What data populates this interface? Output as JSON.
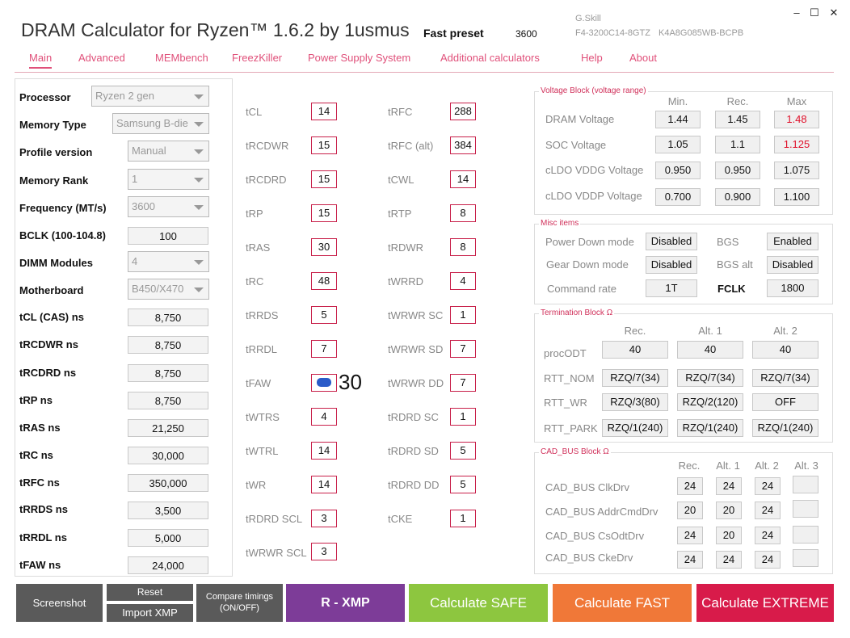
{
  "app": {
    "title": "DRAM Calculator for Ryzen™ 1.6.2 by 1usmus",
    "fast_preset_label": "Fast preset",
    "fast_preset_value": "3600",
    "ram_brand": "G.Skill",
    "ram_model": "F4-3200C14-8GTZ",
    "ram_part": "K4A8G085WB-BCPB",
    "win_minimize": "–",
    "win_maximize": "☐",
    "win_close": "✕"
  },
  "nav": {
    "tabs": [
      "Main",
      "Advanced",
      "MEMbench",
      "FreezKiller",
      "Power Supply System",
      "Additional calculators",
      "Help",
      "About"
    ],
    "active": "Main"
  },
  "left": {
    "processor_label": "Processor",
    "processor_value": "Ryzen 2 gen",
    "memory_type_label": "Memory Type",
    "memory_type_value": "Samsung B-die",
    "profile_label": "Profile version",
    "profile_value": "Manual",
    "rank_label": "Memory Rank",
    "rank_value": "1",
    "freq_label": "Frequency (MT/s)",
    "freq_value": "3600",
    "bclk_label": "BCLK (100-104.8)",
    "bclk_value": "100",
    "dimm_label": "DIMM Modules",
    "dimm_value": "4",
    "mb_label": "Motherboard",
    "mb_value": "B450/X470",
    "ns_rows": [
      {
        "label": "tCL (CAS) ns",
        "value": "8,750"
      },
      {
        "label": "tRCDWR ns",
        "value": "8,750"
      },
      {
        "label": "tRCDRD ns",
        "value": "8,750"
      },
      {
        "label": "tRP ns",
        "value": "8,750"
      },
      {
        "label": "tRAS ns",
        "value": "21,250"
      },
      {
        "label": "tRC ns",
        "value": "30,000"
      },
      {
        "label": "tRFC ns",
        "value": "350,000"
      },
      {
        "label": "tRRDS ns",
        "value": "3,500"
      },
      {
        "label": "tRRDL ns",
        "value": "5,000"
      },
      {
        "label": "tFAW ns",
        "value": "24,000"
      }
    ]
  },
  "timings": {
    "col1": [
      {
        "label": "tCL",
        "value": "14"
      },
      {
        "label": "tRCDWR",
        "value": "15"
      },
      {
        "label": "tRCDRD",
        "value": "15"
      },
      {
        "label": "tRP",
        "value": "15"
      },
      {
        "label": "tRAS",
        "value": "30"
      },
      {
        "label": "tRC",
        "value": "48"
      },
      {
        "label": "tRRDS",
        "value": "5"
      },
      {
        "label": "tRRDL",
        "value": "7"
      },
      {
        "label": "tFAW",
        "value": ""
      },
      {
        "label": "tWTRS",
        "value": "4"
      },
      {
        "label": "tWTRL",
        "value": "14"
      },
      {
        "label": "tWR",
        "value": "14"
      },
      {
        "label": "tRDRD SCL",
        "value": "3"
      },
      {
        "label": "tWRWR SCL",
        "value": "3"
      }
    ],
    "tfaw_overlay": "30",
    "col2": [
      {
        "label": "tRFC",
        "value": "288"
      },
      {
        "label": "tRFC (alt)",
        "value": "384"
      },
      {
        "label": "tCWL",
        "value": "14"
      },
      {
        "label": "tRTP",
        "value": "8"
      },
      {
        "label": "tRDWR",
        "value": "8"
      },
      {
        "label": "tWRRD",
        "value": "4"
      },
      {
        "label": "tWRWR SC",
        "value": "1"
      },
      {
        "label": "tWRWR SD",
        "value": "7"
      },
      {
        "label": "tWRWR DD",
        "value": "7"
      },
      {
        "label": "tRDRD SC",
        "value": "1"
      },
      {
        "label": "tRDRD SD",
        "value": "5"
      },
      {
        "label": "tRDRD DD",
        "value": "5"
      },
      {
        "label": "tCKE",
        "value": "1"
      }
    ]
  },
  "voltage": {
    "title": "Voltage Block (voltage range)",
    "headers": [
      "Min.",
      "Rec.",
      "Max"
    ],
    "rows": [
      {
        "label": "DRAM Voltage",
        "values": [
          "1.44",
          "1.45",
          "1.48"
        ]
      },
      {
        "label": "SOC Voltage",
        "values": [
          "1.05",
          "1.1",
          "1.125"
        ]
      },
      {
        "label": "cLDO VDDG Voltage",
        "values": [
          "0.950",
          "0.950",
          "1.075"
        ]
      },
      {
        "label": "cLDO VDDP Voltage",
        "values": [
          "0.700",
          "0.900",
          "1.100"
        ]
      }
    ],
    "red_color": "#e0102a"
  },
  "misc": {
    "title": "Misc items",
    "power_down_label": "Power Down mode",
    "power_down_value": "Disabled",
    "bgs_label": "BGS",
    "bgs_value": "Enabled",
    "gear_down_label": "Gear Down mode",
    "gear_down_value": "Disabled",
    "bgs_alt_label": "BGS alt",
    "bgs_alt_value": "Disabled",
    "cmd_rate_label": "Command rate",
    "cmd_rate_value": "1T",
    "fclk_label": "FCLK",
    "fclk_value": "1800"
  },
  "termination": {
    "title": "Termination Block Ω",
    "headers": [
      "Rec.",
      "Alt. 1",
      "Alt. 2"
    ],
    "rows": [
      {
        "label": "procODT",
        "values": [
          "40",
          "40",
          "40"
        ]
      },
      {
        "label": "RTT_NOM",
        "values": [
          "RZQ/7(34)",
          "RZQ/7(34)",
          "RZQ/7(34)"
        ]
      },
      {
        "label": "RTT_WR",
        "values": [
          "RZQ/3(80)",
          "RZQ/2(120)",
          "OFF"
        ]
      },
      {
        "label": "RTT_PARK",
        "values": [
          "RZQ/1(240)",
          "RZQ/1(240)",
          "RZQ/1(240)"
        ]
      }
    ]
  },
  "cadbus": {
    "title": "CAD_BUS Block Ω",
    "headers": [
      "Rec.",
      "Alt. 1",
      "Alt. 2",
      "Alt. 3"
    ],
    "rows": [
      {
        "label": "CAD_BUS ClkDrv",
        "values": [
          "24",
          "24",
          "24",
          ""
        ]
      },
      {
        "label": "CAD_BUS AddrCmdDrv",
        "values": [
          "20",
          "20",
          "24",
          ""
        ]
      },
      {
        "label": "CAD_BUS CsOdtDrv",
        "values": [
          "24",
          "20",
          "24",
          ""
        ]
      },
      {
        "label": "CAD_BUS CkeDrv",
        "values": [
          "24",
          "24",
          "24",
          ""
        ]
      }
    ]
  },
  "buttons": {
    "screenshot": "Screenshot",
    "reset": "Reset",
    "import_xmp": "Import XMP",
    "compare_line1": "Compare timings",
    "compare_line2": "(ON/OFF)",
    "r_xmp": "R - XMP",
    "calc_safe": "Calculate SAFE",
    "calc_fast": "Calculate FAST",
    "calc_extreme": "Calculate EXTREME",
    "colors": {
      "gray": "#5a5a5a",
      "purple": "#7d3c98",
      "green": "#8dc63f",
      "orange": "#f07838",
      "red": "#d81b4a"
    }
  }
}
